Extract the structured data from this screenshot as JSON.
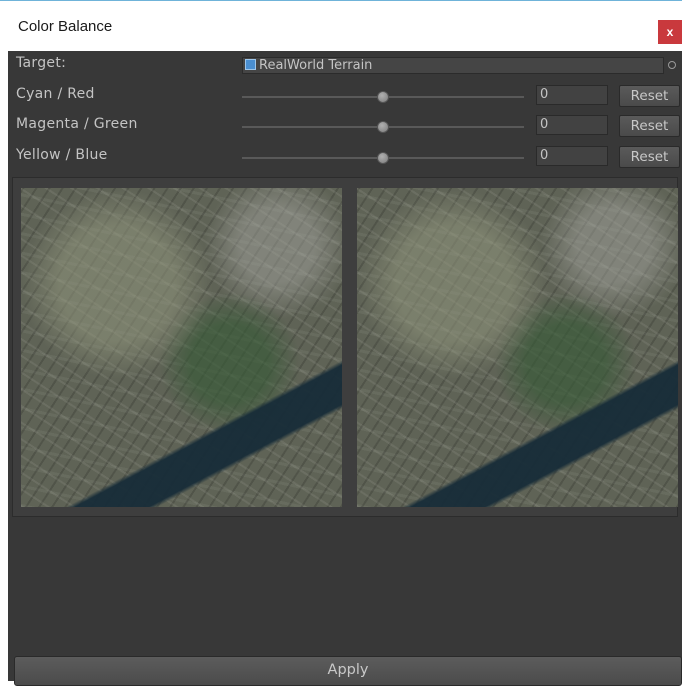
{
  "window": {
    "title": "Color Balance",
    "close_label": "x"
  },
  "target": {
    "label": "Target:",
    "value": "RealWorld Terrain"
  },
  "sliders": [
    {
      "label": "Cyan / Red",
      "value": "0",
      "position": 0.5,
      "reset_label": "Reset"
    },
    {
      "label": "Magenta / Green",
      "value": "0",
      "position": 0.5,
      "reset_label": "Reset"
    },
    {
      "label": "Yellow / Blue",
      "value": "0",
      "position": 0.5,
      "reset_label": "Reset"
    }
  ],
  "preview": {
    "panels": [
      "original",
      "adjusted"
    ]
  },
  "footer": {
    "apply_label": "Apply"
  },
  "colors": {
    "background": "#383838",
    "close": "#c9393d",
    "accent": "#4a8fd1"
  }
}
